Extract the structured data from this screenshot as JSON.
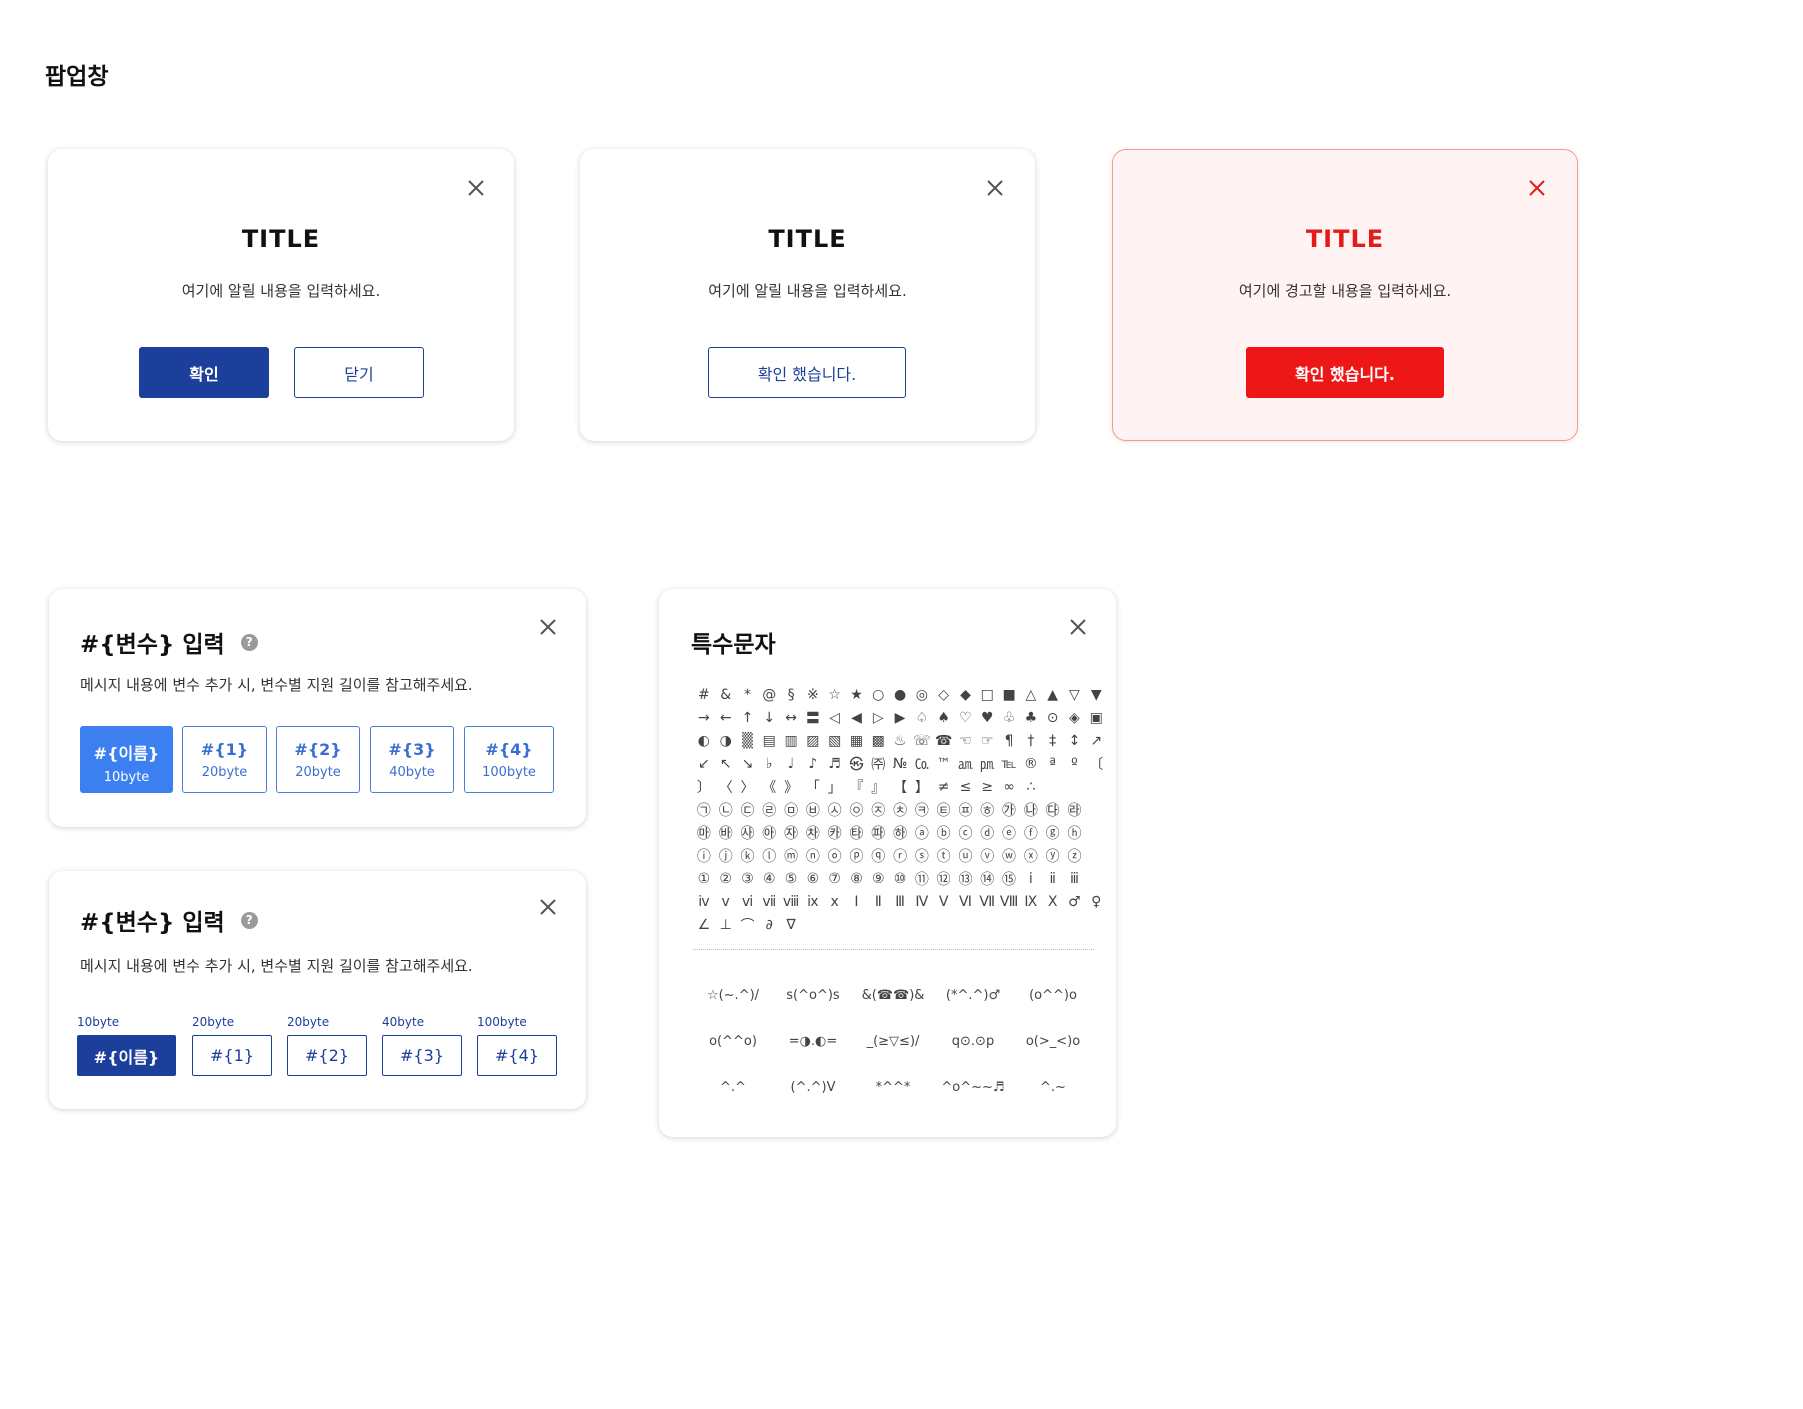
{
  "page": {
    "title": "팝업창"
  },
  "alert1": {
    "title": "TITLE",
    "message": "여기에 알릴 내용을 입력하세요.",
    "confirm_label": "확인",
    "close_label": "닫기"
  },
  "alert2": {
    "title": "TITLE",
    "message": "여기에 알릴 내용을 입력하세요.",
    "confirm_label": "확인 했습니다."
  },
  "alert3": {
    "title": "TITLE",
    "message": "여기에 경고할 내용을 입력하세요.",
    "confirm_label": "확인 했습니다."
  },
  "var_panel1": {
    "title": "#{변수} 입력",
    "help": "?",
    "description": "메시지 내용에 변수 추가 시, 변수별 지원 길이를 참고해주세요.",
    "vars": [
      {
        "label": "#{이름}",
        "byte": "10byte"
      },
      {
        "label": "#{1}",
        "byte": "20byte"
      },
      {
        "label": "#{2}",
        "byte": "20byte"
      },
      {
        "label": "#{3}",
        "byte": "40byte"
      },
      {
        "label": "#{4}",
        "byte": "100byte"
      }
    ]
  },
  "var_panel2": {
    "title": "#{변수} 입력",
    "help": "?",
    "description": "메시지 내용에 변수 추가 시, 변수별 지원 길이를 참고해주세요.",
    "vars": [
      {
        "label": "#{이름}",
        "byte": "10byte"
      },
      {
        "label": "#{1}",
        "byte": "20byte"
      },
      {
        "label": "#{2}",
        "byte": "20byte"
      },
      {
        "label": "#{3}",
        "byte": "40byte"
      },
      {
        "label": "#{4}",
        "byte": "100byte"
      }
    ]
  },
  "special_chars": {
    "title": "특수문자",
    "symbols": [
      [
        "#",
        "&",
        "*",
        "@",
        "§",
        "※",
        "☆",
        "★",
        "○",
        "●",
        "◎",
        "◇",
        "◆",
        "□",
        "■",
        "△",
        "▲",
        "▽",
        "▼"
      ],
      [
        "→",
        "←",
        "↑",
        "↓",
        "↔",
        "〓",
        "◁",
        "◀",
        "▷",
        "▶",
        "♤",
        "♠",
        "♡",
        "♥",
        "♧",
        "♣",
        "⊙",
        "◈",
        "▣"
      ],
      [
        "◐",
        "◑",
        "▒",
        "▤",
        "▥",
        "▨",
        "▧",
        "▦",
        "▩",
        "♨",
        "☏",
        "☎",
        "☜",
        "☞",
        "¶",
        "†",
        "‡",
        "↕",
        "↗"
      ],
      [
        "↙",
        "↖",
        "↘",
        "♭",
        "♩",
        "♪",
        "♬",
        "㉿",
        "㈜",
        "№",
        "㏇",
        "™",
        "㏂",
        "㏘",
        "℡",
        "®",
        "ª",
        "º",
        "〔"
      ],
      [
        "〕",
        "〈",
        "〉",
        "《",
        "》",
        "「",
        "」",
        "『",
        "』",
        "【",
        "】",
        "≠",
        "≤",
        "≥",
        "∞",
        "∴"
      ],
      [
        "㉠",
        "㉡",
        "㉢",
        "㉣",
        "㉤",
        "㉥",
        "㉦",
        "㉧",
        "㉨",
        "㉩",
        "㉪",
        "㉫",
        "㉬",
        "㉭",
        "㉮",
        "㉯",
        "㉰",
        "㉱"
      ],
      [
        "㉲",
        "㉳",
        "㉴",
        "㉵",
        "㉶",
        "㉷",
        "㉸",
        "㉹",
        "㉺",
        "㉻",
        "ⓐ",
        "ⓑ",
        "ⓒ",
        "ⓓ",
        "ⓔ",
        "ⓕ",
        "ⓖ",
        "ⓗ"
      ],
      [
        "ⓘ",
        "ⓙ",
        "ⓚ",
        "ⓛ",
        "ⓜ",
        "ⓝ",
        "ⓞ",
        "ⓟ",
        "ⓠ",
        "ⓡ",
        "ⓢ",
        "ⓣ",
        "ⓤ",
        "ⓥ",
        "ⓦ",
        "ⓧ",
        "ⓨ",
        "ⓩ"
      ],
      [
        "①",
        "②",
        "③",
        "④",
        "⑤",
        "⑥",
        "⑦",
        "⑧",
        "⑨",
        "⑩",
        "⑪",
        "⑫",
        "⑬",
        "⑭",
        "⑮",
        "ⅰ",
        "ⅱ",
        "ⅲ"
      ],
      [
        "ⅳ",
        "ⅴ",
        "ⅵ",
        "ⅶ",
        "ⅷ",
        "ⅸ",
        "ⅹ",
        "Ⅰ",
        "Ⅱ",
        "Ⅲ",
        "Ⅳ",
        "Ⅴ",
        "Ⅵ",
        "Ⅶ",
        "Ⅷ",
        "Ⅸ",
        "Ⅹ",
        "♂",
        "♀"
      ],
      [
        "∠",
        "⊥",
        "⌒",
        "∂",
        "∇"
      ]
    ],
    "emoticons": [
      [
        "☆(~.^)/",
        "s(^o^)s",
        "&(☎☎)&",
        "(*^.^)♂",
        "(o^^)o"
      ],
      [
        "o(^^o)",
        "=◑.◐=",
        "_(≥▽≤)/",
        "q⊙.⊙p",
        "o(>_<)o"
      ],
      [
        "^.^",
        "(^.^)V",
        "*^^*",
        "^o^~~♬",
        "^.~"
      ]
    ]
  }
}
